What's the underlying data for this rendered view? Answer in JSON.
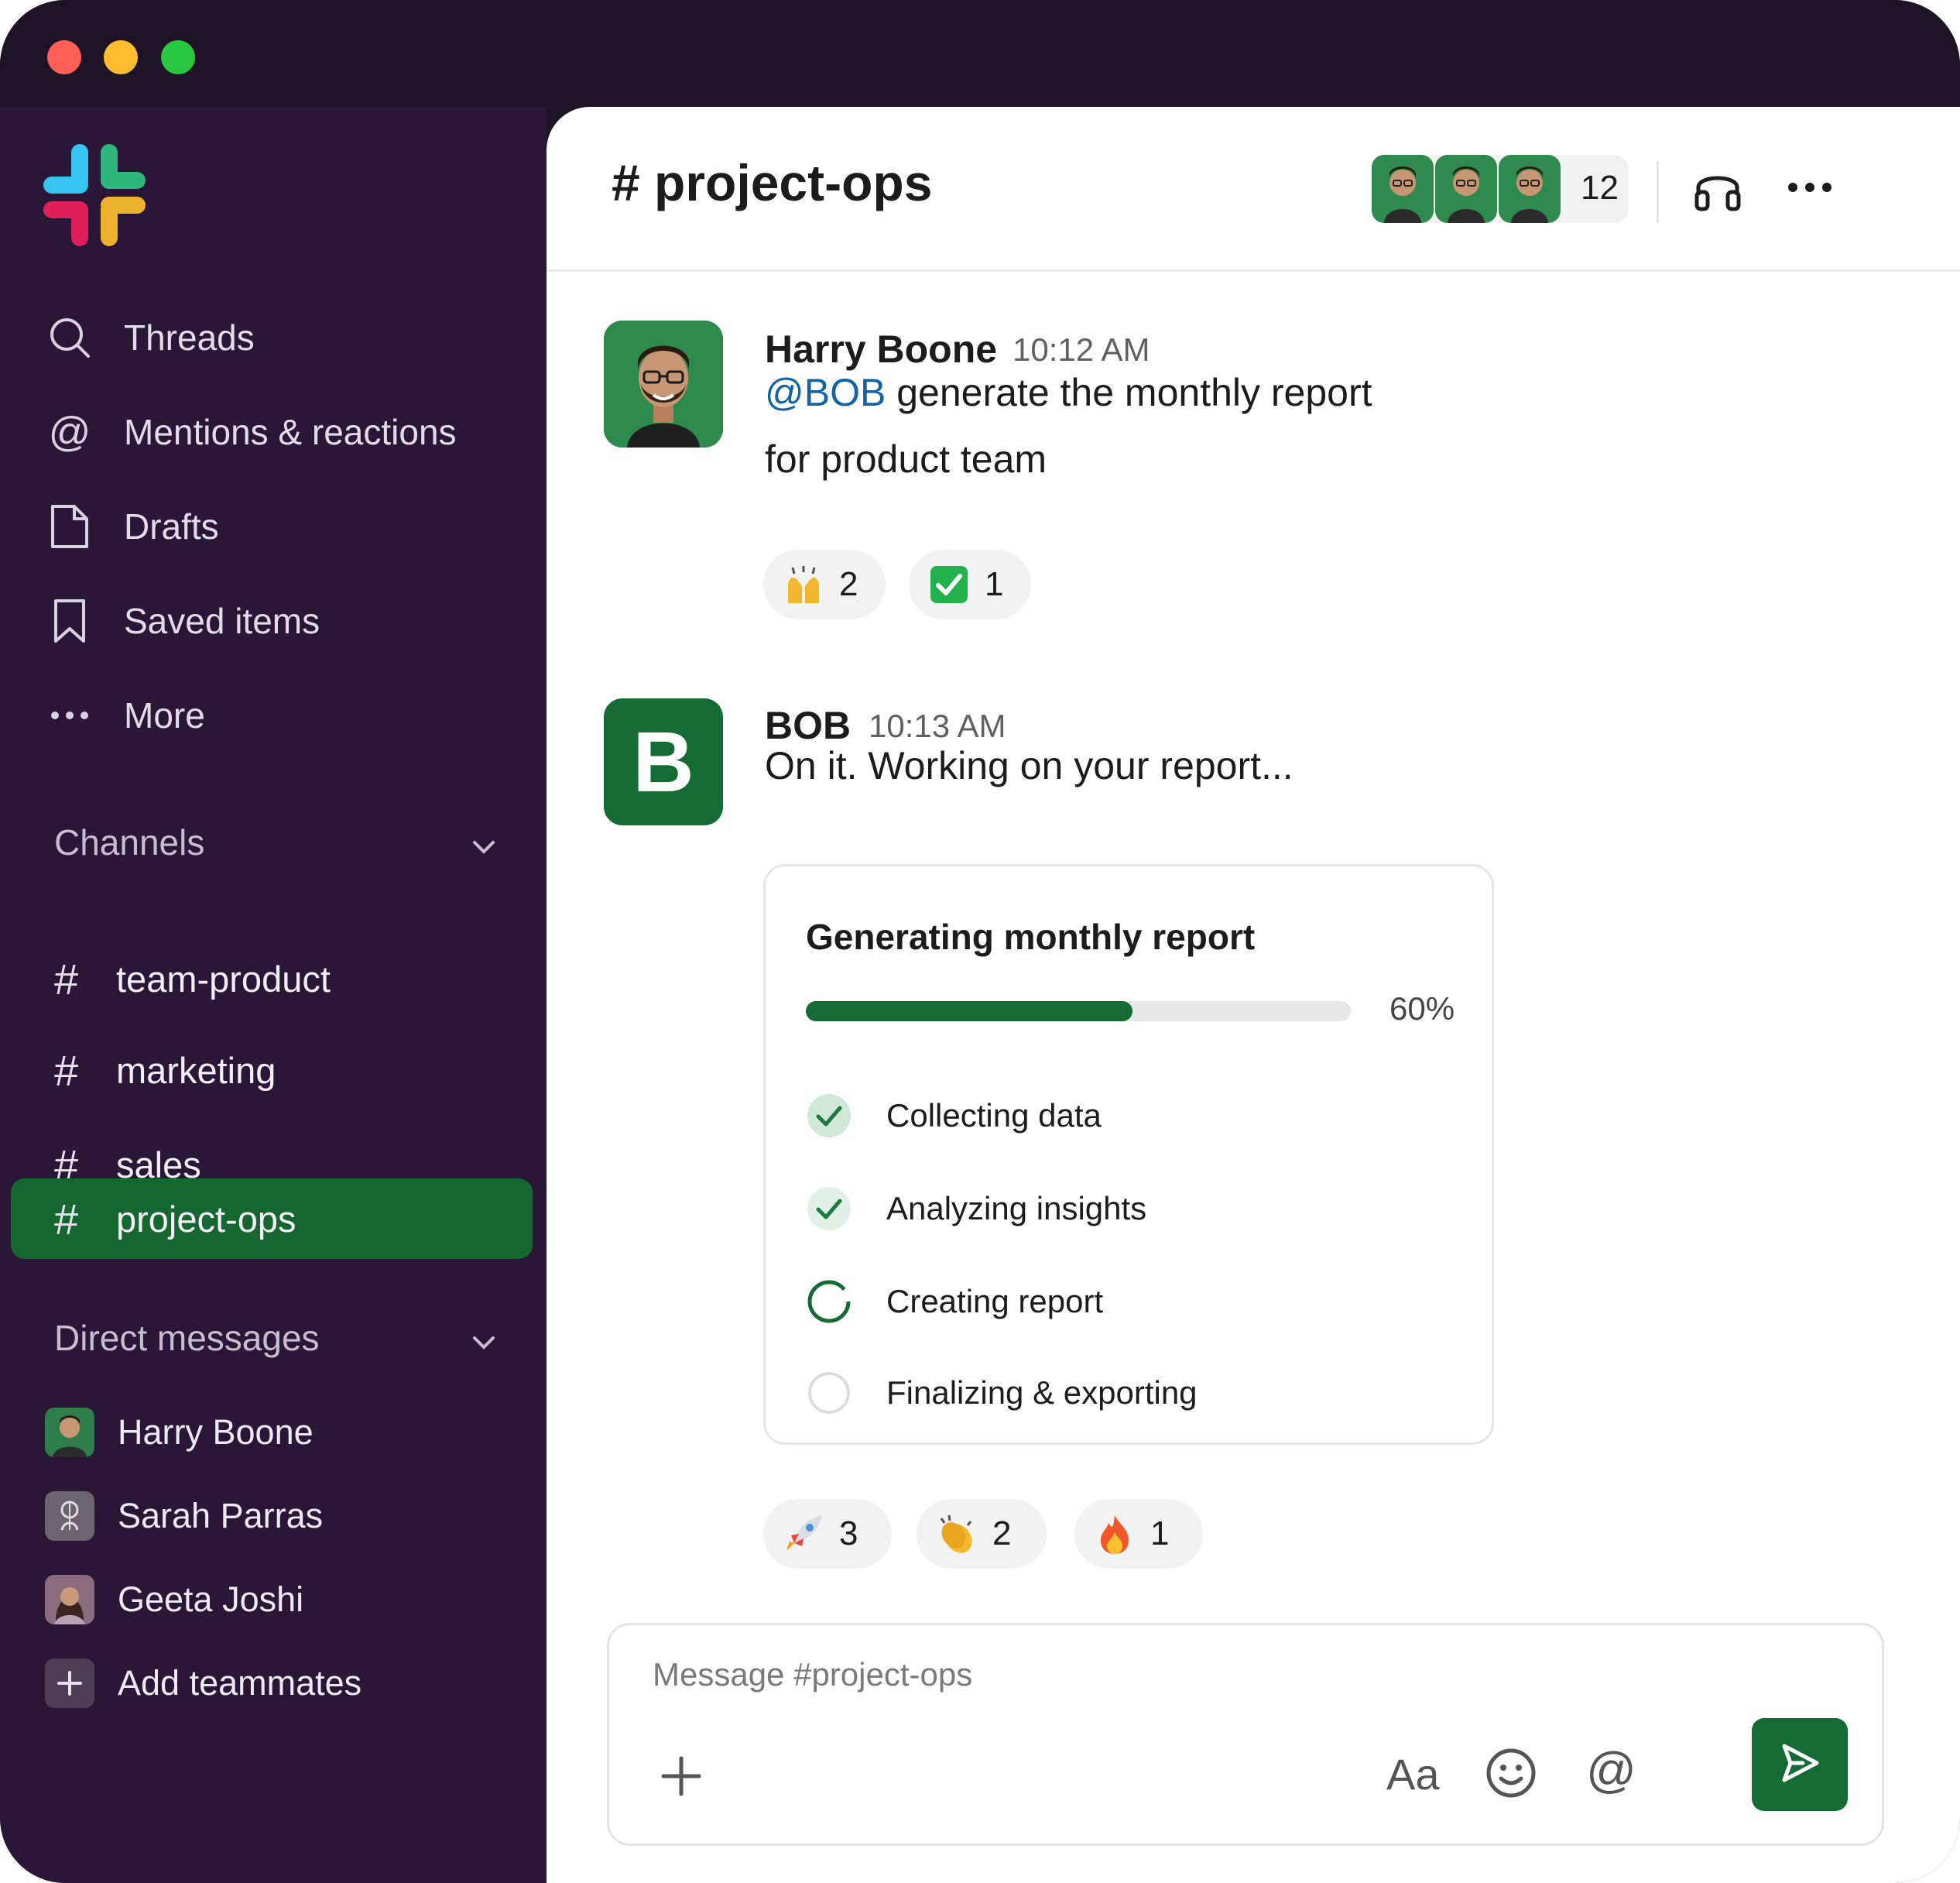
{
  "window": {
    "title_buttons": [
      "close",
      "minimize",
      "zoom"
    ]
  },
  "sidebar": {
    "logo": "slack-logo",
    "nav": [
      {
        "label": "Threads",
        "icon": "search-icon"
      },
      {
        "label": "Mentions & reactions",
        "icon": "at-icon"
      },
      {
        "label": "Drafts",
        "icon": "document-icon"
      },
      {
        "label": "Saved items",
        "icon": "bookmark-icon"
      },
      {
        "label": "More",
        "icon": "ellipsis-icon"
      }
    ],
    "channels_header": "Channels",
    "channels": [
      {
        "hash": "#",
        "name": "team-product",
        "active": false
      },
      {
        "hash": "#",
        "name": "marketing",
        "active": false
      },
      {
        "hash": "#",
        "name": "sales",
        "active": false
      },
      {
        "hash": "#",
        "name": "project-ops",
        "active": true
      }
    ],
    "dm_header": "Direct messages",
    "dms": [
      {
        "name": "Harry Boone"
      },
      {
        "name": "Sarah Parras"
      },
      {
        "name": "Geeta Joshi"
      }
    ],
    "add_teammates": "Add teammates"
  },
  "header": {
    "channel": "# project-ops",
    "member_count": "12"
  },
  "messages": [
    {
      "author": "Harry Boone",
      "time": "10:12 AM",
      "mention": "@BOB",
      "text_line1": " generate the monthly report",
      "text_line2": "for product team",
      "reactions": [
        {
          "emoji": "raised-hands",
          "count": "2"
        },
        {
          "emoji": "check-mark",
          "count": "1"
        }
      ]
    },
    {
      "author": "BOB",
      "avatar_letter": "B",
      "time": "10:13 AM",
      "text": "On it. Working on your report...",
      "reactions": [
        {
          "emoji": "rocket",
          "count": "3"
        },
        {
          "emoji": "clapping-hands",
          "count": "2"
        },
        {
          "emoji": "fire",
          "count": "1"
        }
      ]
    }
  ],
  "report_card": {
    "title": "Generating monthly report",
    "progress": 0.6,
    "progress_label": "60%",
    "steps": [
      {
        "label": "Collecting data",
        "status": "done"
      },
      {
        "label": "Analyzing insights",
        "status": "done"
      },
      {
        "label": "Creating report",
        "status": "in-progress"
      },
      {
        "label": "Finalizing & exporting",
        "status": "pending"
      }
    ]
  },
  "composer": {
    "placeholder": "Message #project-ops",
    "format_label": "Aa",
    "mention_label": "@"
  },
  "colors": {
    "sidebar_bg": "#2a1737",
    "active_channel": "#14672f",
    "accent_green": "#146b34",
    "mention_blue": "#1264a3"
  }
}
